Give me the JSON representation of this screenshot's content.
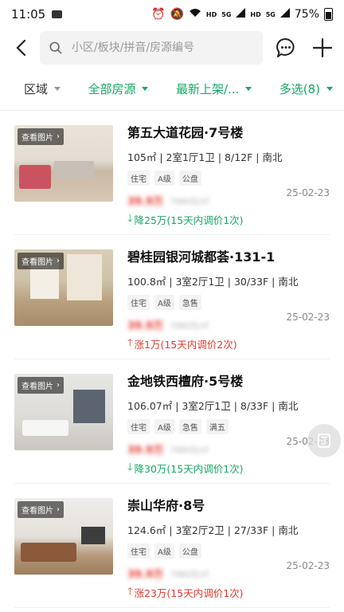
{
  "status_bar": {
    "time": "11:05",
    "hd1": "HD",
    "sig1": "5G",
    "hd2": "HD",
    "sig2": "5G",
    "battery": "75%"
  },
  "search": {
    "placeholder": "小区/板块/拼音/房源编号"
  },
  "filters": [
    {
      "label": "区域"
    },
    {
      "label": "全部房源"
    },
    {
      "label": "最新上架/..."
    },
    {
      "label": "多选(8)"
    }
  ],
  "thumb_badge": "查看图片",
  "listings": [
    {
      "title": "第五大道花园·7号楼",
      "specs": "105㎡ | 2室1厅1卫 | 8/12F | 南北",
      "tags": [
        "住宅",
        "A级",
        "公盘"
      ],
      "price": "39.9万",
      "unit_price": "7980元/㎡",
      "date": "25-02-23",
      "change_direction": "down",
      "change": "降25万(15天内调价1次)"
    },
    {
      "title": "碧桂园银河城都荟·131-1",
      "specs": "100.8㎡ | 3室2厅1卫 | 30/33F | 南北",
      "tags": [
        "住宅",
        "A级",
        "急售"
      ],
      "price": "39.9万",
      "unit_price": "7980元/㎡",
      "date": "25-02-23",
      "change_direction": "up",
      "change": "涨1万(15天内调价2次)"
    },
    {
      "title": "金地铁西檀府·5号楼",
      "specs": "106.07㎡ | 3室2厅1卫 | 8/33F | 南北",
      "tags": [
        "住宅",
        "A级",
        "急售",
        "满五"
      ],
      "price": "39.9万",
      "unit_price": "7980元/㎡",
      "date": "25-02-23",
      "change_direction": "down",
      "change": "降30万(15天内调价1次)"
    },
    {
      "title": "崇山华府·8号",
      "specs": "124.6㎡ | 3室2厅2卫 | 27/33F | 南北",
      "tags": [
        "住宅",
        "A级",
        "公盘"
      ],
      "price": "39.9万",
      "unit_price": "7980元/㎡",
      "date": "25-02-23",
      "change_direction": "up",
      "change": "涨23万(15天内调价1次)"
    }
  ],
  "colors": {
    "green": "#17a864",
    "red": "#e2372c"
  }
}
